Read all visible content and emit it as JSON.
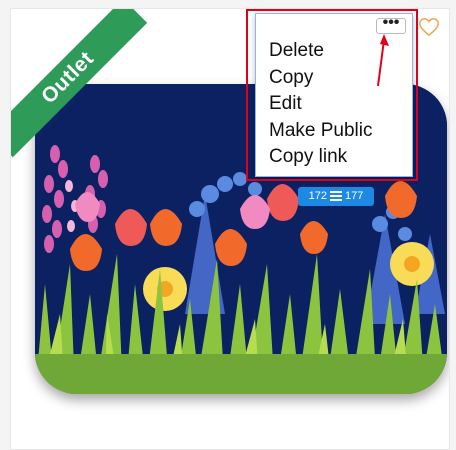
{
  "badge": {
    "label": "Outlet",
    "color": "#2e9b58"
  },
  "favorite": {
    "icon": "heart-outline-icon",
    "color": "#f0a24a"
  },
  "menu": {
    "more_label": "•••",
    "items": [
      {
        "label": "Delete"
      },
      {
        "label": "Copy"
      },
      {
        "label": "Edit"
      },
      {
        "label": "Make Public"
      },
      {
        "label": "Copy link"
      }
    ]
  },
  "dimensions": {
    "left": "172",
    "right": "177"
  },
  "colors": {
    "highlight": "#e0001b",
    "tray_background": "#0b2161",
    "dimension_badge": "#1e88e5"
  }
}
